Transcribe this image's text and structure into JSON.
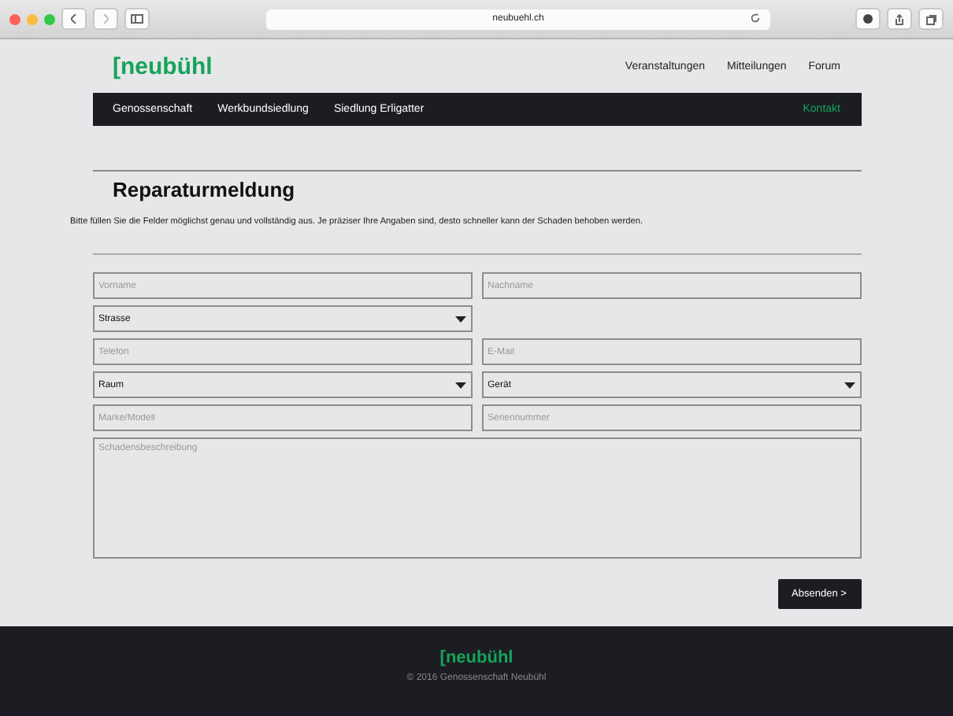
{
  "browser": {
    "url": "neubuehl.ch"
  },
  "header": {
    "logo": "[neubühl",
    "links": [
      "Veranstaltungen",
      "Mitteilungen",
      "Forum"
    ]
  },
  "nav": {
    "items": [
      {
        "label": "Genossenschaft",
        "selected": false
      },
      {
        "label": "Werkbundsiedlung",
        "selected": false
      },
      {
        "label": "Siedlung Erligatter",
        "selected": false
      }
    ],
    "contact": {
      "label": "Kontakt",
      "selected": true
    }
  },
  "form": {
    "title": "Reparaturmeldung",
    "intro": "Bitte füllen Sie die Felder möglichst genau und vollständig aus. Je präziser Ihre Angaben sind, desto schneller kann der Schaden behoben werden.",
    "rows": [
      [
        {
          "kind": "input",
          "placeholder": "Vorname"
        },
        {
          "kind": "input",
          "placeholder": "Nachname"
        }
      ],
      [
        {
          "kind": "select",
          "value": "Strasse"
        }
      ],
      [
        {
          "kind": "input",
          "placeholder": "Telefon"
        },
        {
          "kind": "input",
          "placeholder": "E-Mail"
        }
      ],
      [
        {
          "kind": "select",
          "value": "Raum"
        },
        {
          "kind": "select",
          "value": "Gerät"
        }
      ],
      [
        {
          "kind": "input",
          "placeholder": "Marke/Modell"
        },
        {
          "kind": "input",
          "placeholder": "Seriennummer"
        }
      ],
      [
        {
          "kind": "textarea",
          "placeholder": "Schadensbeschreibung"
        }
      ]
    ],
    "submit": "Absenden >"
  },
  "footer": {
    "logo": "[neubühl",
    "copyright": "© 2016 Genossenschaft Neubühl"
  }
}
